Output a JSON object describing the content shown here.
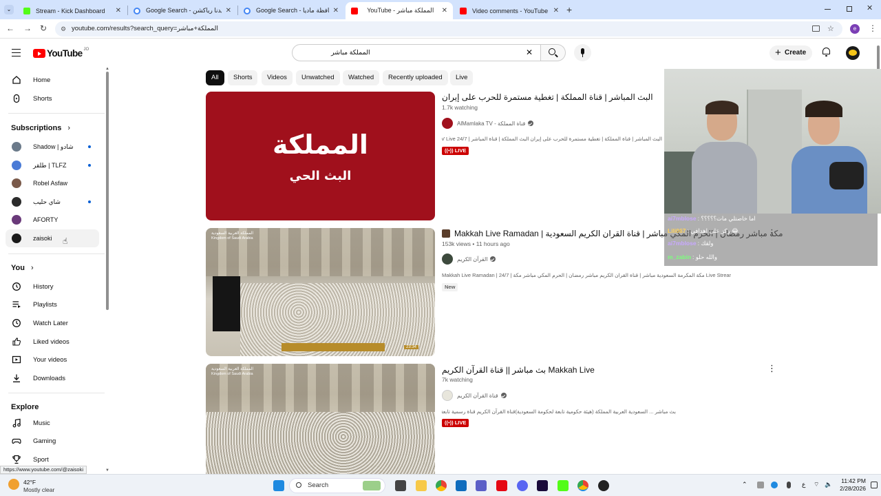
{
  "browser": {
    "tabs": [
      {
        "title": "Stream - Kick Dashboard",
        "fav_color": "#53fc18"
      },
      {
        "title": "Google Search - تقاليدنا رياكشن",
        "fav_color": "#4285f4"
      },
      {
        "title": "Google Search - مساحة محافظة ماديا",
        "fav_color": "#4285f4"
      },
      {
        "title": "YouTube - المملكة مباشر",
        "fav_color": "#ff0000"
      },
      {
        "title": "Video comments - YouTube Stu...",
        "fav_color": "#ff0000"
      }
    ],
    "new_tab_label": "+",
    "url": "youtube.com/results?search_query=المملكة+مباشر"
  },
  "youtube": {
    "logo_text": "YouTube",
    "logo_country": "JO",
    "search_value": "المملكة مباشر",
    "create_label": "Create"
  },
  "sidebar": {
    "main": [
      {
        "label": "Home",
        "icon": "home-icon"
      },
      {
        "label": "Shorts",
        "icon": "shorts-icon"
      }
    ],
    "subscriptions_title": "Subscriptions",
    "subscriptions": [
      {
        "label": "Shadow | شادو",
        "color": "#6b7a8a",
        "dot": true
      },
      {
        "label": "طلقر | TLFZ",
        "color": "#4a7bd6",
        "dot": true
      },
      {
        "label": "Robel Asfaw",
        "color": "#7a5a4a",
        "dot": false
      },
      {
        "label": "شاي حليب",
        "color": "#2b2b2b",
        "dot": true
      },
      {
        "label": "AFORTY",
        "color": "#6a3a7a",
        "dot": false
      },
      {
        "label": "zaisoki",
        "color": "#1a1a1a",
        "dot": false
      }
    ],
    "you_title": "You",
    "you": [
      {
        "label": "History",
        "icon": "history-icon"
      },
      {
        "label": "Playlists",
        "icon": "playlists-icon"
      },
      {
        "label": "Watch Later",
        "icon": "watch-later-icon"
      },
      {
        "label": "Liked videos",
        "icon": "liked-icon"
      },
      {
        "label": "Your videos",
        "icon": "your-videos-icon"
      },
      {
        "label": "Downloads",
        "icon": "download-icon"
      }
    ],
    "explore_title": "Explore",
    "explore": [
      {
        "label": "Music",
        "icon": "music-icon"
      },
      {
        "label": "Gaming",
        "icon": "gaming-icon"
      },
      {
        "label": "Sport",
        "icon": "trophy-icon"
      }
    ]
  },
  "chips": [
    "All",
    "Shorts",
    "Videos",
    "Unwatched",
    "Watched",
    "Recently uploaded",
    "Live"
  ],
  "results": [
    {
      "title": "البث المباشر | قناة المملكة | تغطية مستمرة للحرب على إيران",
      "meta": "1.7k watching",
      "channel": "AlMamlaka TV - قناة المملكة",
      "description": "البث المباشر | قناة المملكة | تغطية مستمرة للحرب على إيران البث المملكة | قناة المباشر | AlMamlaka TV Live 24/7 بث",
      "badge": "LIVE",
      "thumb_text_1": "المملكة",
      "thumb_text_2": "البث الحي"
    },
    {
      "title": "Makkah Live Ramadan | مكة مباشر رمضان | الحرم المكي مباشر | قناة القران الكريم السعودية",
      "meta": "153k views • 11 hours ago",
      "channel": "القرآن الكريم",
      "description": "Makkah Live Ramadan | مكة المكرمة السعودية مباشر | قناة القران الكريم مباشر رمضان | الحرم المكي مباشر مكة | 24/7 Live Stream ...",
      "badge": "New",
      "thumb_caption": "المملكة العربية السعودية",
      "thumb_caption_2": "Kingdom of Saudi Arabia",
      "thumb_time": "23:34"
    },
    {
      "title": "بث مباشر || قناة القرآن الكريم Makkah Live",
      "meta": "7k watching",
      "channel": "قناة القرآن الكريم",
      "description": "بث مباشر ... السعودية العربية المملكة (هيئة حكومية تابعة لحكومة السعودية)قناة القرآن الكريم قناة رسمية تابعة للهيئة الإذاعة والتلفزيون",
      "badge": "LIVE",
      "thumb_caption": "المملكة العربية السعودية",
      "thumb_caption_2": "Kingdom of Saudi Arabia"
    }
  ],
  "chat": [
    {
      "user": "ai7mblose",
      "text": ": اما خاصتلي مات؟؟؟؟؟",
      "color": "#c8a8ff"
    },
    {
      "user": "Lili067",
      "text": ": ركز على اهدافي 😂",
      "color": "#ffd35c"
    },
    {
      "user": "ai7mblose",
      "text": ": ولقك",
      "color": "#c8a8ff"
    },
    {
      "user": "m_zabin",
      "text": ": والله حلو",
      "color": "#7cff7c"
    }
  ],
  "status_url": "https://www.youtube.com/@zaisoki",
  "taskbar": {
    "weather_temp": "42°F",
    "weather_desc": "Mostly clear",
    "search_label": "Search",
    "time": "11:42 PM",
    "date": "2/28/2026"
  }
}
